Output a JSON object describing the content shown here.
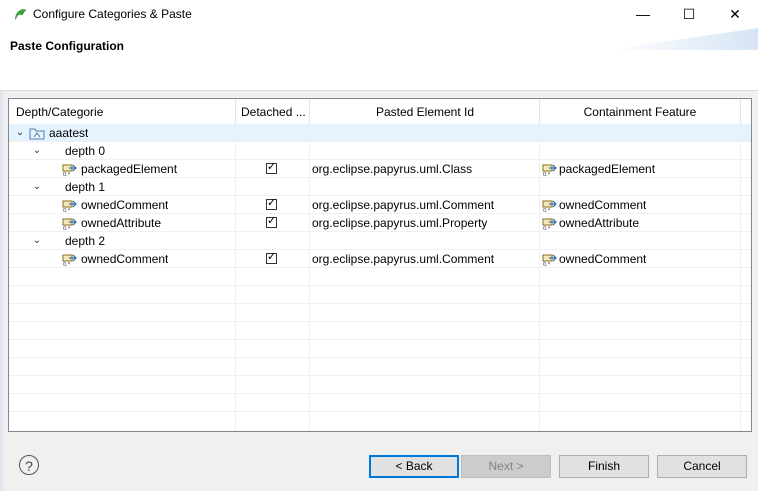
{
  "window": {
    "title": "Configure Categories & Paste",
    "minimize_glyph": "—",
    "maximize_glyph": "☐",
    "close_glyph": "✕"
  },
  "header": {
    "title": "Paste Configuration"
  },
  "table": {
    "columns": [
      "Depth/Categorie",
      "Detached ...",
      "Pasted Element Id",
      "Containment Feature"
    ],
    "root": {
      "label": "aaatest"
    },
    "depths": [
      {
        "label": "depth 0",
        "children": [
          {
            "label": "packagedElement",
            "detached": true,
            "element_id": "org.eclipse.papyrus.uml.Class",
            "feature": "packagedElement"
          }
        ]
      },
      {
        "label": "depth 1",
        "children": [
          {
            "label": "ownedComment",
            "detached": true,
            "element_id": "org.eclipse.papyrus.uml.Comment",
            "feature": "ownedComment"
          },
          {
            "label": "ownedAttribute",
            "detached": true,
            "element_id": "org.eclipse.papyrus.uml.Property",
            "feature": "ownedAttribute"
          }
        ]
      },
      {
        "label": "depth 2",
        "children": [
          {
            "label": "ownedComment",
            "detached": true,
            "element_id": "org.eclipse.papyrus.uml.Comment",
            "feature": "ownedComment"
          }
        ]
      }
    ]
  },
  "buttons": {
    "help": "?",
    "back": "< Back",
    "next": "Next >",
    "finish": "Finish",
    "cancel": "Cancel"
  },
  "colors": {
    "selection": "#e5f3ff",
    "primary_border": "#0078d7",
    "app_icon_green": "#3aa637"
  }
}
